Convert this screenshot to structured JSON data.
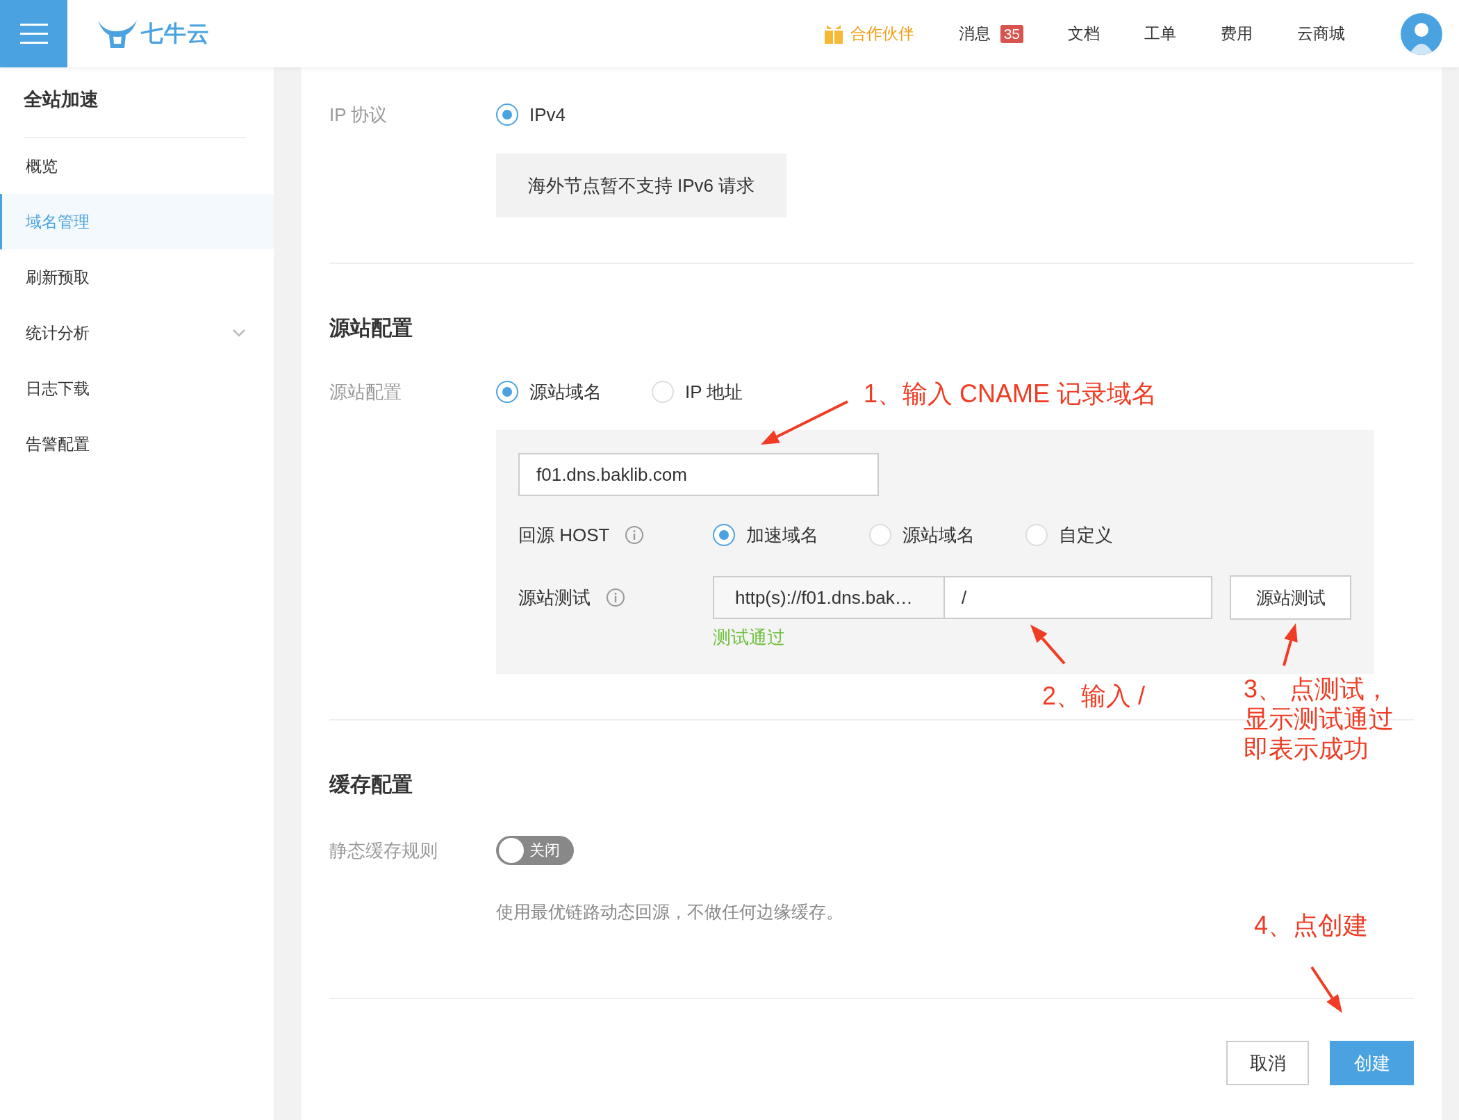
{
  "topbar": {
    "logo": "七牛云",
    "nav": [
      {
        "kind": "partner",
        "label": "合作伙伴"
      },
      {
        "kind": "link",
        "label": "消息",
        "badge": "35"
      },
      {
        "kind": "link",
        "label": "文档"
      },
      {
        "kind": "link",
        "label": "工单"
      },
      {
        "kind": "link",
        "label": "费用"
      },
      {
        "kind": "link",
        "label": "云商城"
      }
    ]
  },
  "sidebar": {
    "title": "全站加速",
    "items": [
      {
        "label": "概览",
        "selected": false,
        "kind": "link"
      },
      {
        "label": "域名管理",
        "selected": true,
        "kind": "link"
      },
      {
        "label": "刷新预取",
        "selected": false,
        "kind": "link"
      },
      {
        "label": "统计分析",
        "selected": false,
        "kind": "group",
        "expanded": false
      },
      {
        "label": "日志下载",
        "selected": false,
        "kind": "link"
      },
      {
        "label": "告警配置",
        "selected": false,
        "kind": "link"
      }
    ]
  },
  "ip_protocol": {
    "label": "IP 协议",
    "options": [
      {
        "label": "IPv4",
        "selected": true
      }
    ],
    "notice": "海外节点暂不支持 IPv6 请求"
  },
  "origin": {
    "title": "源站配置",
    "type_label": "源站配置",
    "types": [
      {
        "label": "源站域名",
        "selected": true
      },
      {
        "label": "IP 地址",
        "selected": false
      }
    ],
    "domain": "f01.dns.baklib.com",
    "host": {
      "label": "回源 HOST",
      "options": [
        {
          "label": "加速域名",
          "selected": true
        },
        {
          "label": "源站域名",
          "selected": false
        },
        {
          "label": "自定义",
          "selected": false
        }
      ]
    },
    "test": {
      "label": "源站测试",
      "prefix": "http(s)://f01.dns.bak…",
      "path": "/",
      "button": "源站测试",
      "result": "测试通过"
    }
  },
  "cache": {
    "title": "缓存配置",
    "rule_label": "静态缓存规则",
    "toggle": {
      "on": false,
      "label": "关闭"
    },
    "description": "使用最优链路动态回源，不做任何边缘缓存。"
  },
  "actions": {
    "cancel": "取消",
    "create": "创建"
  },
  "annotations": [
    {
      "lines": [
        "1、输入 CNAME 记录域名"
      ]
    },
    {
      "lines": [
        "2、输入 /"
      ]
    },
    {
      "lines": [
        "3、 点测试，",
        "显示测试通过",
        "即表示成功"
      ]
    },
    {
      "lines": [
        "4、点创建"
      ]
    }
  ]
}
